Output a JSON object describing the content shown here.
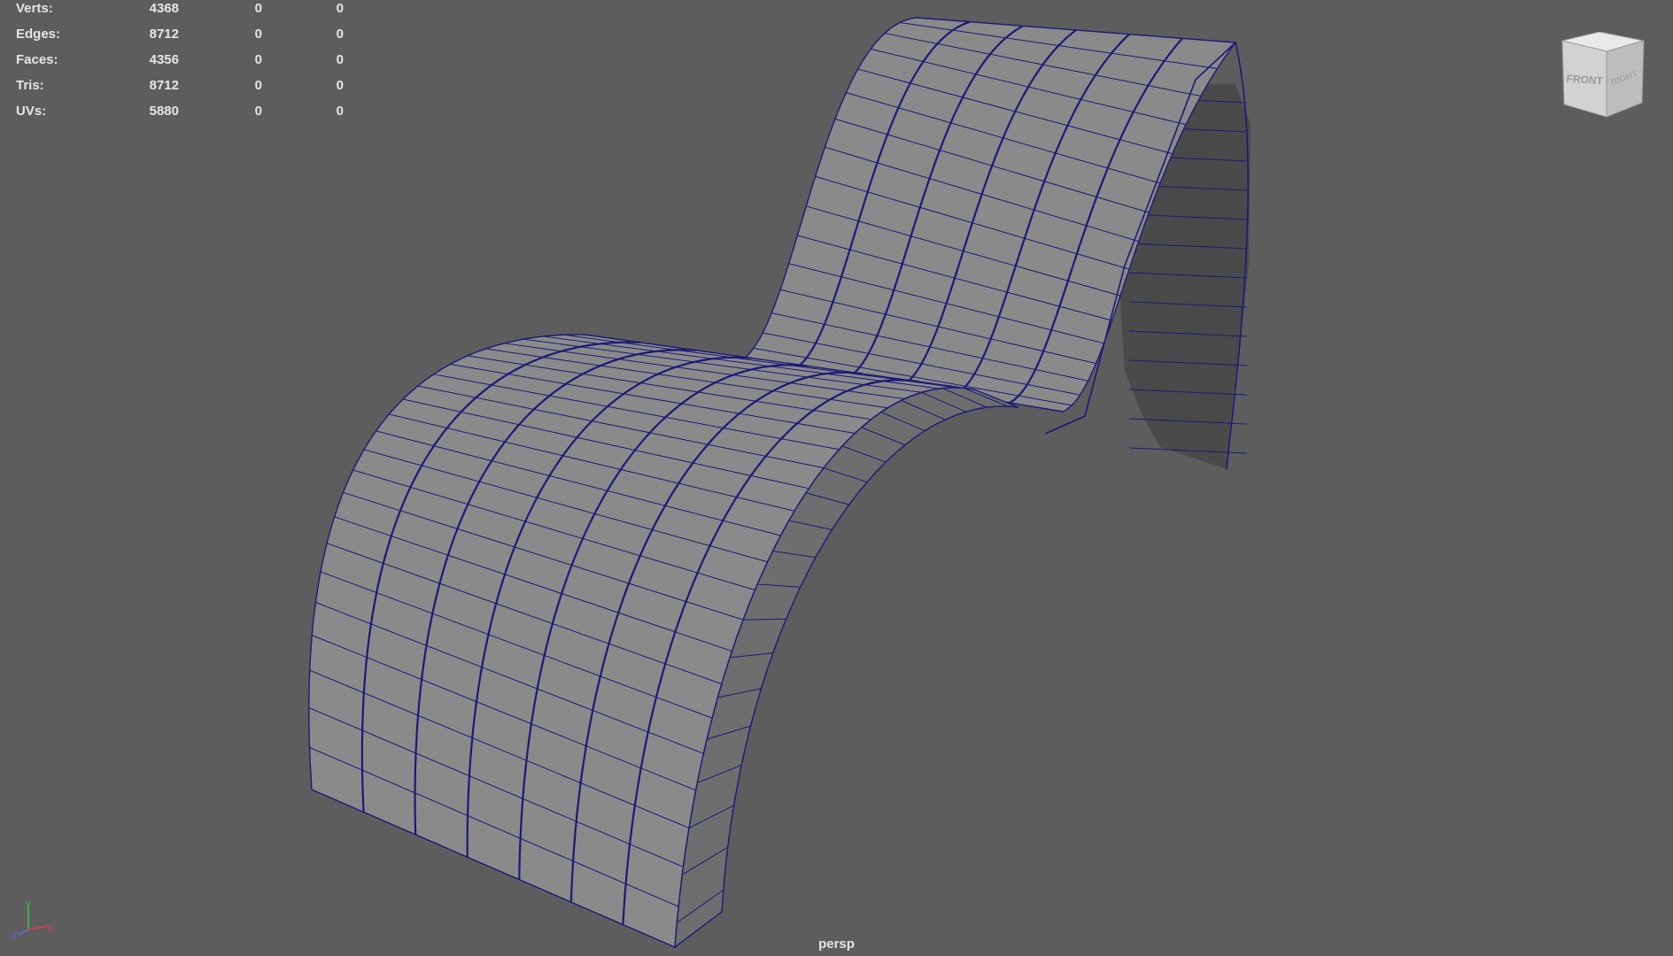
{
  "heads_up_display": {
    "rows": [
      {
        "label": "Verts:",
        "values": [
          "4368",
          "0",
          "0"
        ]
      },
      {
        "label": "Edges:",
        "values": [
          "8712",
          "0",
          "0"
        ]
      },
      {
        "label": "Faces:",
        "values": [
          "4356",
          "0",
          "0"
        ]
      },
      {
        "label": "Tris:",
        "values": [
          "8712",
          "0",
          "0"
        ]
      },
      {
        "label": "UVs:",
        "values": [
          "5880",
          "0",
          "0"
        ]
      }
    ]
  },
  "viewport": {
    "camera_label": "persp",
    "background_color": "#5d5d5d",
    "wireframe_color": "#1b1a78",
    "surface_color": "#8a8a8a"
  },
  "view_cube": {
    "front_label": "FRONT",
    "right_label": "RIGHT"
  },
  "axis_gizmo": {
    "x_label": "x",
    "y_label": "y",
    "z_label": "z"
  }
}
